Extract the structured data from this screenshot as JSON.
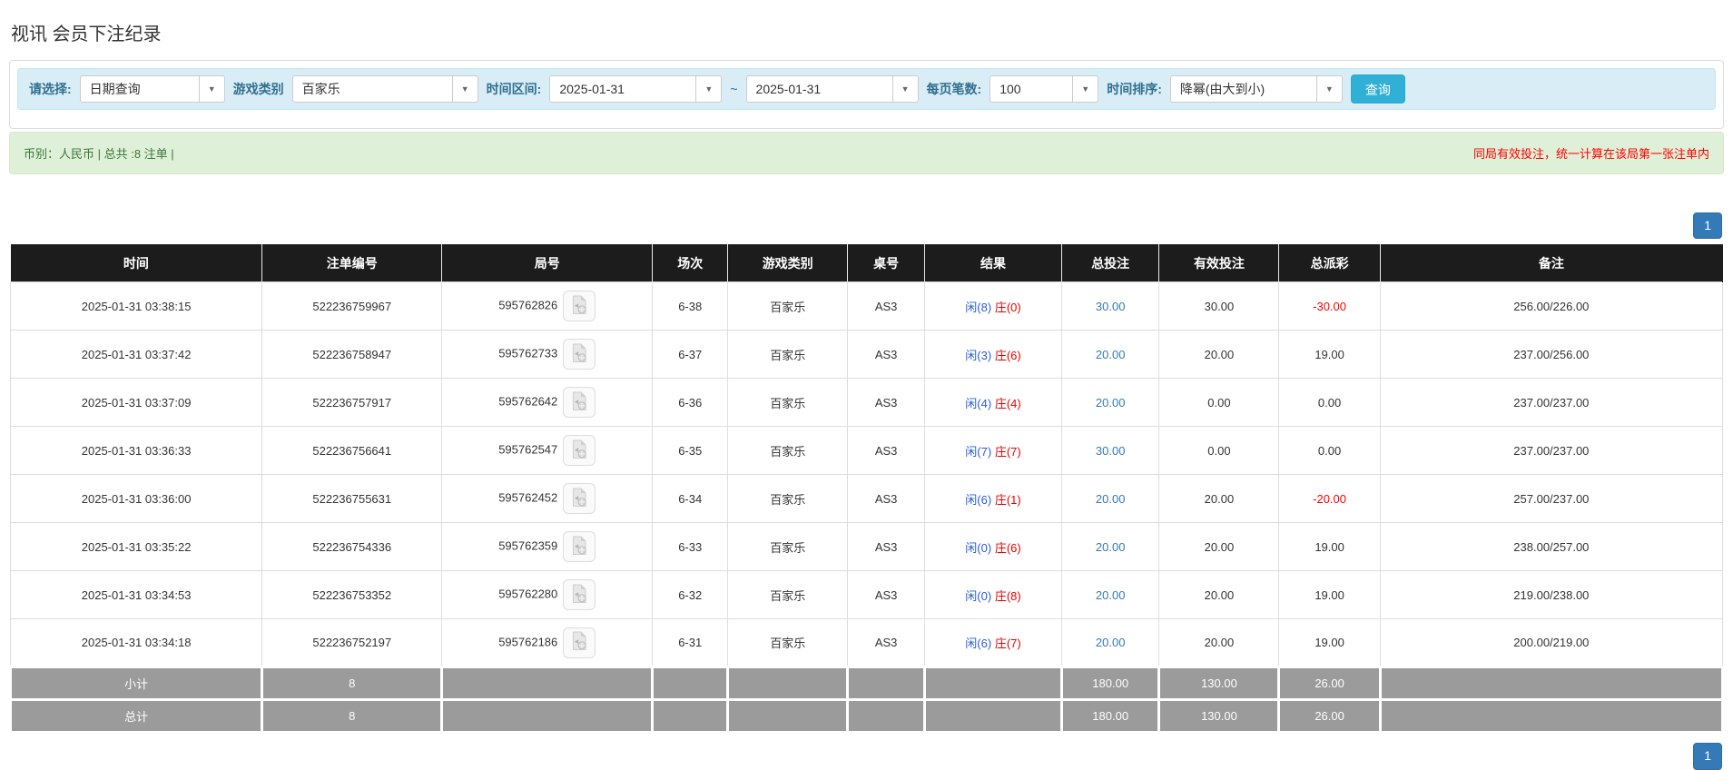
{
  "page": {
    "title": "视讯 会员下注纪录"
  },
  "filters": {
    "select_label": "请选择:",
    "select_value": "日期查询",
    "game_type_label": "游戏类别",
    "game_type_value": "百家乐",
    "time_range_label": "时间区间:",
    "date_from": "2025-01-31",
    "range_separator": "~",
    "date_to": "2025-01-31",
    "page_size_label": "每页笔数:",
    "page_size_value": "100",
    "sort_label": "时间排序:",
    "sort_value": "降幂(由大到小)",
    "search_button": "查询"
  },
  "summary": {
    "left_text": "币别：人民币 | 总共 :8 注单 |",
    "right_notice": "同局有效投注，统一计算在该局第一张注单内"
  },
  "pagination": {
    "page": "1"
  },
  "table": {
    "columns": [
      "时间",
      "注单编号",
      "局号",
      "场次",
      "游戏类别",
      "桌号",
      "结果",
      "总投注",
      "有效投注",
      "总派彩",
      "备注"
    ],
    "rows": [
      {
        "time": "2025-01-31 03:38:15",
        "bet_no": "522236759967",
        "round_no": "595762826",
        "session": "6-38",
        "game": "百家乐",
        "table_no": "AS3",
        "result_player": "闲(8)",
        "result_banker": "庄(0)",
        "total_bet": "30.00",
        "valid_bet": "30.00",
        "payout": "-30.00",
        "remark": "256.00/226.00"
      },
      {
        "time": "2025-01-31 03:37:42",
        "bet_no": "522236758947",
        "round_no": "595762733",
        "session": "6-37",
        "game": "百家乐",
        "table_no": "AS3",
        "result_player": "闲(3)",
        "result_banker": "庄(6)",
        "total_bet": "20.00",
        "valid_bet": "20.00",
        "payout": "19.00",
        "remark": "237.00/256.00"
      },
      {
        "time": "2025-01-31 03:37:09",
        "bet_no": "522236757917",
        "round_no": "595762642",
        "session": "6-36",
        "game": "百家乐",
        "table_no": "AS3",
        "result_player": "闲(4)",
        "result_banker": "庄(4)",
        "total_bet": "20.00",
        "valid_bet": "0.00",
        "payout": "0.00",
        "remark": "237.00/237.00"
      },
      {
        "time": "2025-01-31 03:36:33",
        "bet_no": "522236756641",
        "round_no": "595762547",
        "session": "6-35",
        "game": "百家乐",
        "table_no": "AS3",
        "result_player": "闲(7)",
        "result_banker": "庄(7)",
        "total_bet": "30.00",
        "valid_bet": "0.00",
        "payout": "0.00",
        "remark": "237.00/237.00"
      },
      {
        "time": "2025-01-31 03:36:00",
        "bet_no": "522236755631",
        "round_no": "595762452",
        "session": "6-34",
        "game": "百家乐",
        "table_no": "AS3",
        "result_player": "闲(6)",
        "result_banker": "庄(1)",
        "total_bet": "20.00",
        "valid_bet": "20.00",
        "payout": "-20.00",
        "remark": "257.00/237.00"
      },
      {
        "time": "2025-01-31 03:35:22",
        "bet_no": "522236754336",
        "round_no": "595762359",
        "session": "6-33",
        "game": "百家乐",
        "table_no": "AS3",
        "result_player": "闲(0)",
        "result_banker": "庄(6)",
        "total_bet": "20.00",
        "valid_bet": "20.00",
        "payout": "19.00",
        "remark": "238.00/257.00"
      },
      {
        "time": "2025-01-31 03:34:53",
        "bet_no": "522236753352",
        "round_no": "595762280",
        "session": "6-32",
        "game": "百家乐",
        "table_no": "AS3",
        "result_player": "闲(0)",
        "result_banker": "庄(8)",
        "total_bet": "20.00",
        "valid_bet": "20.00",
        "payout": "19.00",
        "remark": "219.00/238.00"
      },
      {
        "time": "2025-01-31 03:34:18",
        "bet_no": "522236752197",
        "round_no": "595762186",
        "session": "6-31",
        "game": "百家乐",
        "table_no": "AS3",
        "result_player": "闲(6)",
        "result_banker": "庄(7)",
        "total_bet": "20.00",
        "valid_bet": "20.00",
        "payout": "19.00",
        "remark": "200.00/219.00"
      }
    ],
    "subtotal": {
      "label": "小计",
      "count": "8",
      "total_bet": "180.00",
      "valid_bet": "130.00",
      "payout": "26.00"
    },
    "total": {
      "label": "总计",
      "count": "8",
      "total_bet": "180.00",
      "valid_bet": "130.00",
      "payout": "26.00"
    }
  },
  "colors": {
    "accent_button": "#31b0d5",
    "pagination_blue": "#337ab7",
    "link_blue": "#337ab7",
    "player_blue": "#2b5cd9",
    "banker_red": "#e60000",
    "negative_red": "#ff0000",
    "header_bg": "#1c1c1c",
    "filter_bar_bg": "#d9edf7",
    "summary_bg": "#dff0d8",
    "summary_text": "#3c763d",
    "totals_bg": "#9b9b9b"
  }
}
